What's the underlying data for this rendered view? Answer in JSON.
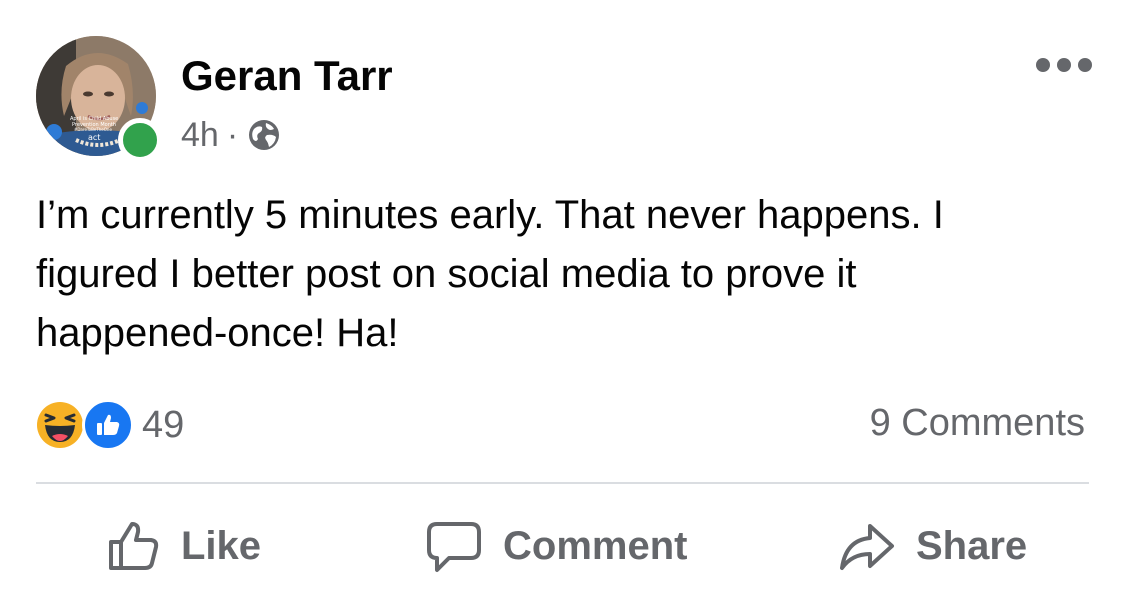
{
  "post": {
    "author": {
      "name": "Geran Tarr",
      "avatar_frame_text": [
        "April is Child Abuse",
        "Prevention Month",
        "#DareToBeTheOne",
        "act"
      ],
      "online": true
    },
    "timestamp": "4h",
    "separator": "·",
    "privacy_icon": "globe-icon",
    "more_icon": "more-options-icon",
    "text_lines": [
      "I’m currently 5 minutes early. That never happens. I",
      "figured I better post on social media to prove it",
      "happened-once! Ha!"
    ],
    "reactions": {
      "icons": [
        "haha-reaction-icon",
        "like-reaction-icon"
      ],
      "count": "49"
    },
    "comments_label": "9 Comments"
  },
  "actions": {
    "like_label": "Like",
    "comment_label": "Comment",
    "share_label": "Share"
  },
  "colors": {
    "text_primary": "#050505",
    "text_secondary": "#65676b",
    "like_blue": "#1877f2",
    "online_green": "#31a24c",
    "divider": "#dadde1"
  }
}
